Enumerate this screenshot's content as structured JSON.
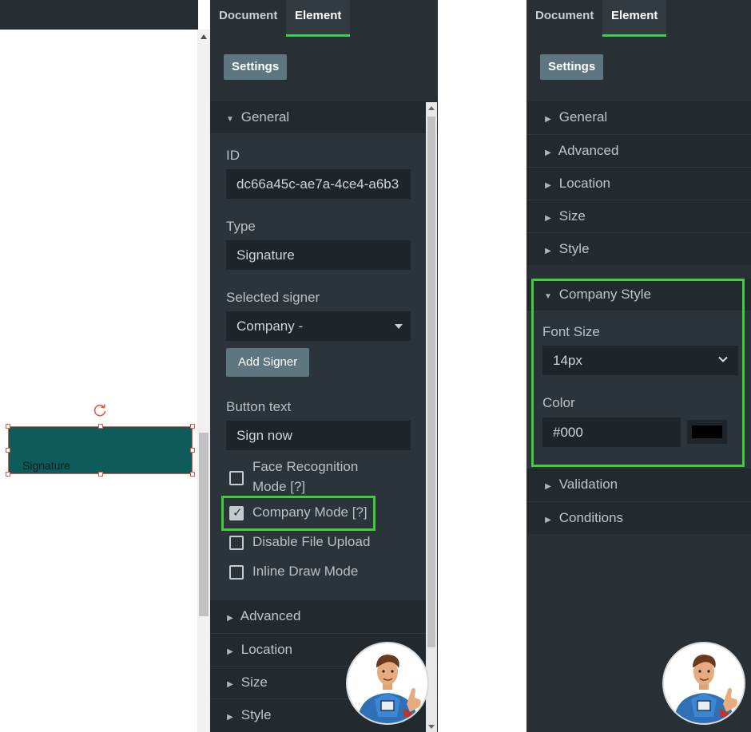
{
  "canvas": {
    "signature_label": "Signature"
  },
  "panel_left": {
    "tabs": [
      "Document",
      "Element"
    ],
    "active_tab": "Element",
    "settings_label": "Settings",
    "general_title": "General",
    "fields": {
      "id_label": "ID",
      "id_value": "dc66a45c-ae7a-4ce4-a6b3",
      "type_label": "Type",
      "type_value": "Signature",
      "signer_label": "Selected signer",
      "signer_value": "Company -",
      "add_signer_label": "Add Signer",
      "button_text_label": "Button text",
      "button_text_value": "Sign now"
    },
    "checkboxes": [
      {
        "label_line1": "Face Recognition",
        "label_line2": "Mode [?]",
        "checked": false
      },
      {
        "label": "Company Mode [?]",
        "checked": true
      },
      {
        "label": "Disable File Upload",
        "checked": false
      },
      {
        "label": "Inline Draw Mode",
        "checked": false
      }
    ],
    "collapsed_sections": [
      "Advanced",
      "Location",
      "Size",
      "Style"
    ]
  },
  "panel_right": {
    "tabs": [
      "Document",
      "Element"
    ],
    "active_tab": "Element",
    "settings_label": "Settings",
    "sections_top": [
      "General",
      "Advanced",
      "Location",
      "Size",
      "Style"
    ],
    "company_style": {
      "title": "Company Style",
      "font_size_label": "Font Size",
      "font_size_value": "14px",
      "color_label": "Color",
      "color_value": "#000"
    },
    "sections_bottom": [
      "Validation",
      "Conditions"
    ]
  },
  "colors": {
    "panel_bg": "#283036",
    "accent_green": "#37d34a",
    "signature_fill": "#0e5b5b",
    "button_bg": "#5e7680"
  },
  "icons": [
    "rotate-icon",
    "caret-down-icon",
    "chevron-right-icon",
    "chevron-down-icon",
    "checkmark-icon",
    "mascot-avatar"
  ]
}
